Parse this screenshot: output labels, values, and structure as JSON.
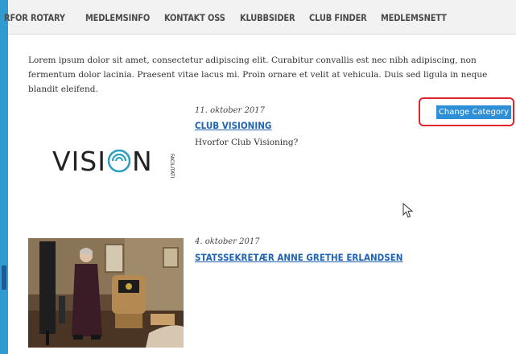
{
  "nav": {
    "items": [
      {
        "label": "RFOR ROTARY"
      },
      {
        "label": "MEDLEMSINFO"
      },
      {
        "label": "KONTAKT OSS"
      },
      {
        "label": "KLUBBSIDER"
      },
      {
        "label": "CLUB FINDER"
      },
      {
        "label": "MEDLEMSNETT"
      }
    ]
  },
  "intro": {
    "text": "Lorem ipsum dolor sit amet, consectetur adipiscing elit. Curabitur convallis est nec nibh adipiscing, non fermentum dolor lacinia. Praesent vitae lacus mi. Proin ornare et velit at vehicula. Duis sed ligula in neque blandit eleifend."
  },
  "posts": [
    {
      "date": "11. oktober 2017",
      "title": "CLUB VISIONING",
      "excerpt": "Hvorfor Club Visioning?",
      "logo": {
        "word_left": "VISI",
        "word_o": "O",
        "word_right": "N",
        "tag": "FACILITATION",
        "icon": "vision-logo"
      }
    },
    {
      "date": "4. oktober 2017",
      "title": "STATSSEKRETÆR ANNE GRETHE ERLANDSEN",
      "image": "photo-woman-speaking-at-lectern"
    }
  ],
  "actions": {
    "change_category_label": "Change Category"
  },
  "colors": {
    "accent": "#2f9bd0",
    "link": "#1f63b5",
    "button": "#2f8fd6",
    "highlight": "#e0242b"
  }
}
